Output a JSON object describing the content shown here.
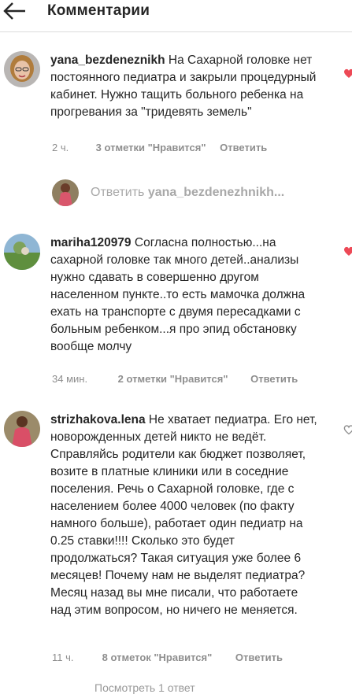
{
  "header": {
    "title": "Комментарии"
  },
  "comments": [
    {
      "username": "yana_bezdeneznikh",
      "text": "На Сахарной головке нет постоянного педиатра и закрыли процедурный кабинет. Нужно тащить больного ребенка на прогревания за \"тридевять земель\"",
      "time": "2 ч.",
      "likes": "3 отметки \"Нравится\"",
      "reply_label": "Ответить"
    },
    {
      "username": "mariha120979",
      "text": "Согласна полностью...на сахарной головке так много детей..анализы нужно сдавать в совершенно другом населенном пункте..то есть мамочка должна ехать на транспорте с двумя пересадками с больным ребенком...я про эпид обстановку вообще молчу",
      "time": "34 мин.",
      "likes": "2 отметки \"Нравится\"",
      "reply_label": "Ответить"
    },
    {
      "username": "strizhakova.lena",
      "text": "Не хватает педиатра. Его нет, новорожденных детей никто не ведёт. Справляйсь родители как бюджет позволяет, возите в платные клиники или в соседние поселения. Речь о Сахарной головке, где с населением более 4000 человек (по факту намного больше), работает один педиатр на 0.25 ставки!!!! Сколько это будет продолжаться? Такая ситуация уже более 6 месяцев! Почему нам не выделят педиатра? Месяц назад вы мне писали, что работаете над этим вопросом, но ничего не меняется.",
      "time": "11 ч.",
      "likes": "8 отметок \"Нравится\"",
      "reply_label": "Ответить"
    }
  ],
  "reply_box": {
    "prefix": "Ответить",
    "target": "yana_bezdenezhnikh..."
  },
  "bottom_partial": "Посмотреть 1 ответ",
  "colors": {
    "heart_red": "#ed4956",
    "meta_gray": "#8e8e8e",
    "text": "#262626"
  },
  "icons": {
    "back": "arrow-left-icon",
    "like": "heart-icon"
  }
}
